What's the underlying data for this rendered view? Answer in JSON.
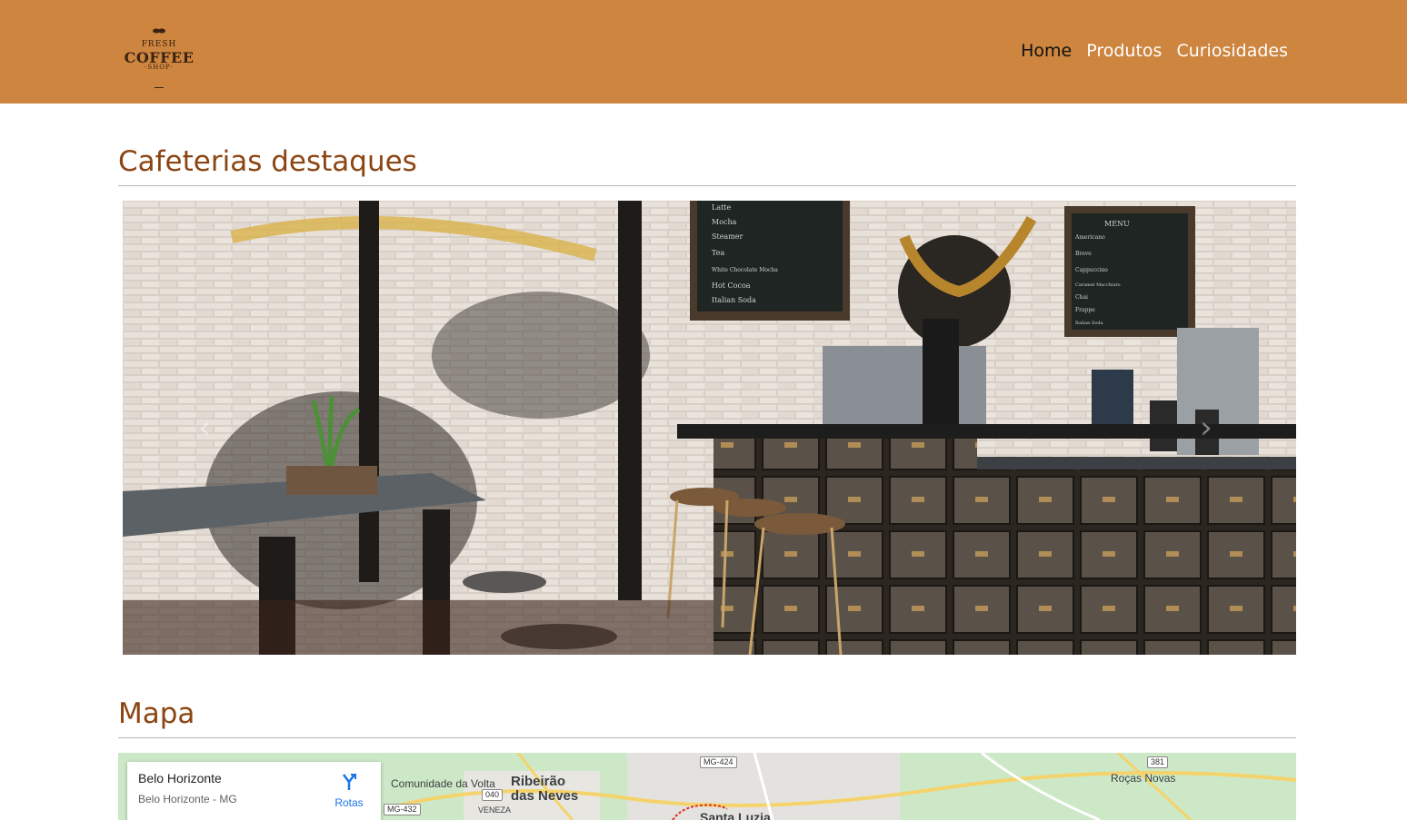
{
  "header": {
    "logo": {
      "line1": "FRESH",
      "line2": "COFFEE",
      "line3": "·SHOP·"
    },
    "nav": [
      "Home",
      "Produtos",
      "Curiosidades"
    ],
    "active": "Home",
    "color": "#cd853f"
  },
  "sections": {
    "featured_title": "Cafeterias destaques",
    "map_title": "Mapa"
  },
  "carousel": {
    "prev_icon": "chevron-left-icon",
    "next_icon": "chevron-right-icon",
    "menu_board_title": "MENU",
    "menu_left_items": [
      "Latte",
      "Mocha",
      "Steamer",
      "Tea",
      "White Chocolate Mocha",
      "Hot Cocoa",
      "Italian Soda"
    ],
    "menu_right_items": [
      "Americano",
      "Breve",
      "Cappuccino",
      "Caramel Macchiato",
      "Chai",
      "Frappe",
      "Italian Soda"
    ]
  },
  "map": {
    "place": "Belo Horizonte",
    "subtitle": "Belo Horizonte - MG",
    "directions_label": "Rotas",
    "labels": [
      "Comunidade da Volta",
      "Ribeirão das Neves",
      "Santa Luzia",
      "Roças Novas",
      "VENEZA"
    ],
    "shields": [
      "MG-424",
      "040",
      "MG-432",
      "381"
    ]
  },
  "colors": {
    "heading": "#8b4513",
    "nav_active": "#111111",
    "nav": "#ffffff"
  }
}
